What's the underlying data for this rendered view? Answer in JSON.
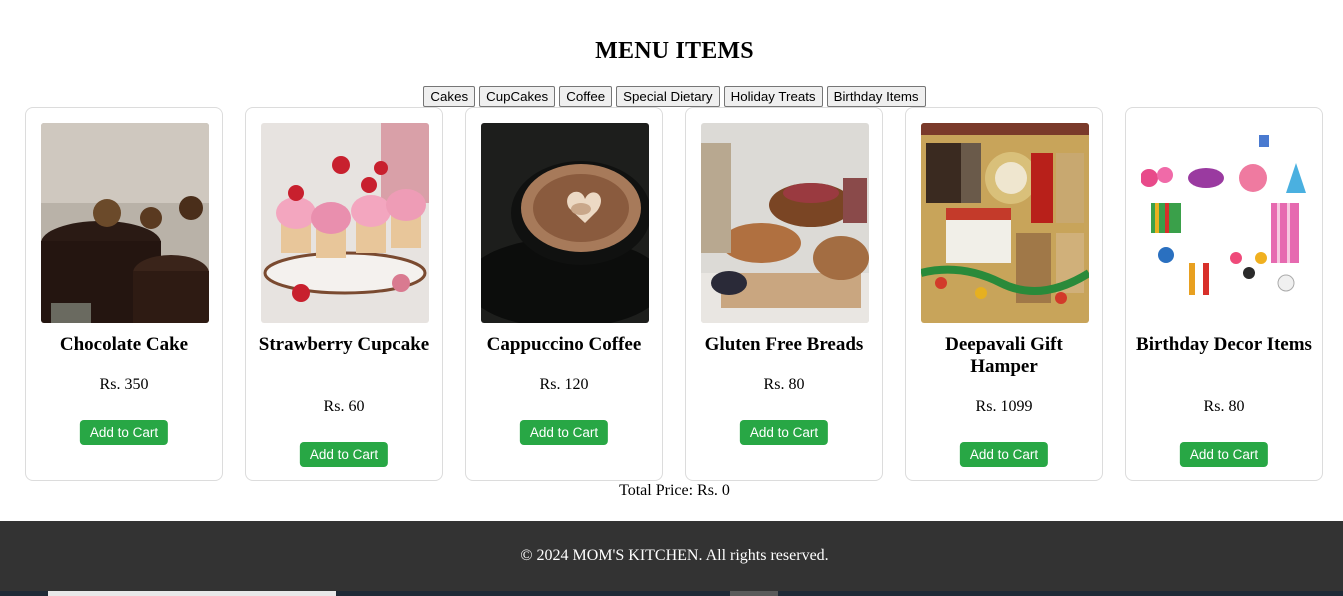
{
  "title": "MENU ITEMS",
  "filters": [
    "Cakes",
    "CupCakes",
    "Coffee",
    "Special Dietary",
    "Holiday Treats",
    "Birthday Items"
  ],
  "items": [
    {
      "name": "Chocolate Cake",
      "price": "Rs. 350",
      "button": "Add to Cart"
    },
    {
      "name": "Strawberry Cupcake",
      "price": "Rs. 60",
      "button": "Add to Cart"
    },
    {
      "name": "Cappuccino Coffee",
      "price": "Rs. 120",
      "button": "Add to Cart"
    },
    {
      "name": "Gluten Free Breads",
      "price": "Rs. 80",
      "button": "Add to Cart"
    },
    {
      "name": "Deepavali Gift Hamper",
      "price": "Rs. 1099",
      "button": "Add to Cart"
    },
    {
      "name": "Birthday Decor Items",
      "price": "Rs. 80",
      "button": "Add to Cart"
    }
  ],
  "total": "Total Price: Rs. 0",
  "footer": "© 2024 MOM'S KITCHEN. All rights reserved.",
  "colors": {
    "button": "#28a745",
    "footer_bg": "#333333"
  }
}
